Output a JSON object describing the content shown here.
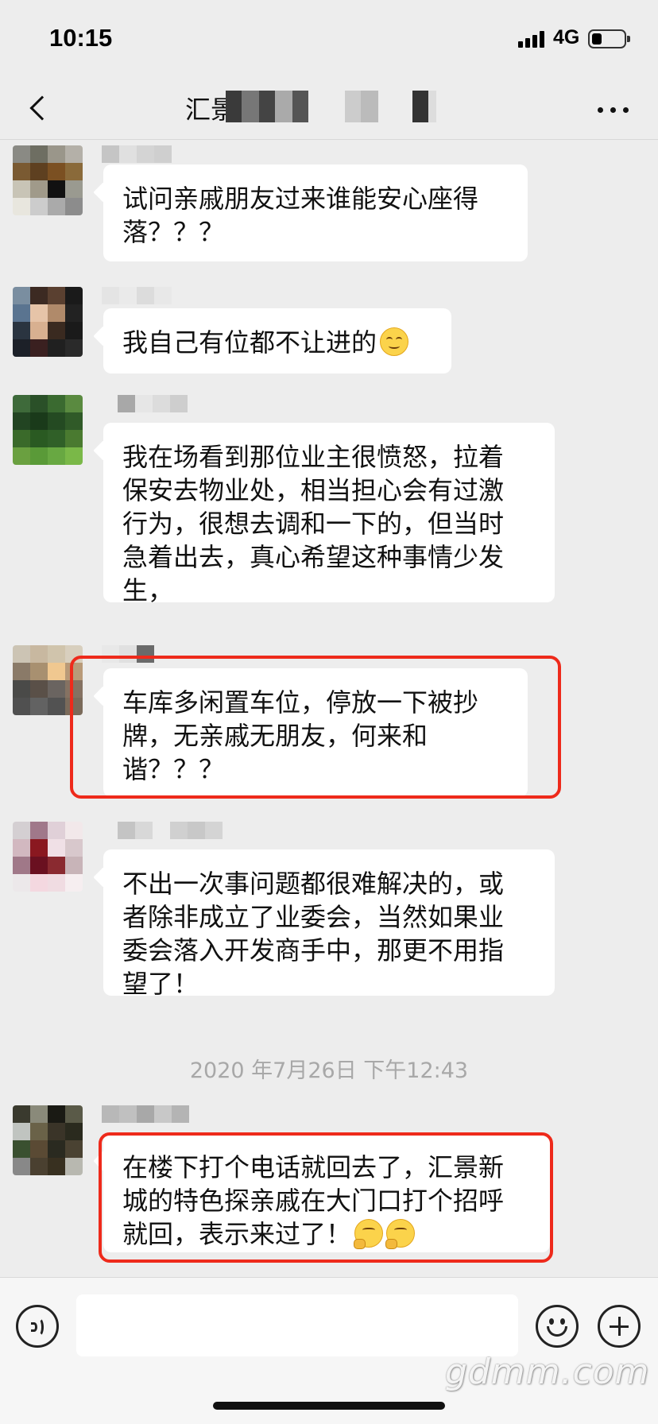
{
  "status_bar": {
    "time": "10:15",
    "network": "4G"
  },
  "nav": {
    "title_visible": "汇景"
  },
  "timestamp": "2020 年7月26日 下午12:43",
  "messages": [
    {
      "lines": [
        "试问亲戚朋友过来谁能安心座得",
        "落？？？"
      ]
    },
    {
      "lines": [
        "我自己有位都不让进的"
      ],
      "emoji": "smiling-face"
    },
    {
      "lines": [
        "我在场看到那位业主很愤怒，拉着",
        "保安去物业处，相当担心会有过激",
        "行为，很想去调和一下的，但当时",
        "急着出去，真心希望这种事情少发",
        "生，"
      ]
    },
    {
      "lines": [
        "车库多闲置车位，停放一下被抄",
        "牌，无亲戚无朋友，何来和",
        "谐？？？"
      ],
      "highlighted": true
    },
    {
      "lines": [
        "不出一次事问题都很难解决的，或",
        "者除非成立了业委会，当然如果业",
        "委会落入开发商手中，那更不用指",
        "望了！"
      ]
    },
    {
      "lines": [
        "在楼下打个电话就回去了，汇景新",
        "城的特色探亲戚在大门口打个招呼",
        "就回，表示来过了！"
      ],
      "emoji": "thinking-face-x2",
      "highlighted": true
    }
  ],
  "colors": {
    "background": "#ededed",
    "bubble": "#ffffff",
    "highlight": "#ee2a1b",
    "timestamp": "#a8a8a8"
  },
  "icons": [
    "back-icon",
    "more-icon",
    "voice-icon",
    "emoji-icon",
    "plus-icon"
  ],
  "watermark": "gdmm.com"
}
